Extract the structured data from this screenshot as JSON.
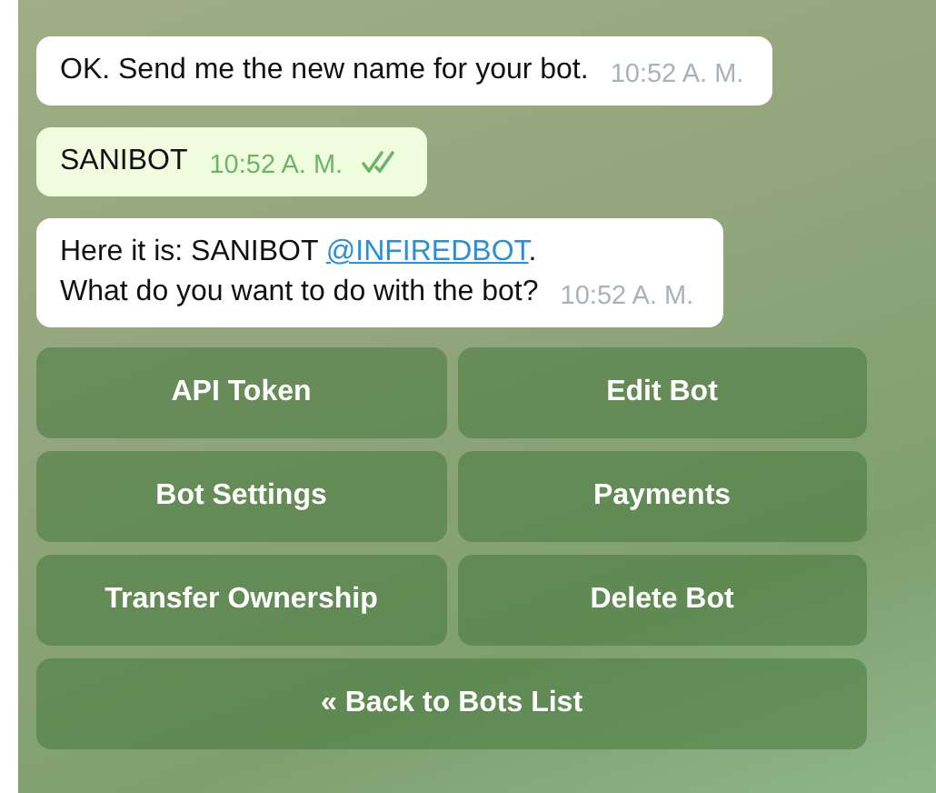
{
  "messages": [
    {
      "kind": "incoming",
      "lines": [
        [
          {
            "kind": "text",
            "text": "OK. Send me the new name for your bot."
          }
        ]
      ],
      "time": "10:52 A. M."
    },
    {
      "kind": "outgoing",
      "lines": [
        [
          {
            "kind": "text",
            "text": "SANIBOT"
          }
        ]
      ],
      "time": "10:52 A. M.",
      "read": true
    },
    {
      "kind": "incoming",
      "lines": [
        [
          {
            "kind": "text",
            "text": "Here it is: SANIBOT "
          },
          {
            "kind": "link",
            "text": "@INFIREDBOT"
          },
          {
            "kind": "text",
            "text": "."
          }
        ],
        [
          {
            "kind": "text",
            "text": "What do you want to do with the bot?"
          }
        ]
      ],
      "time": "10:52 A. M."
    }
  ],
  "keyboard": [
    [
      "API Token",
      "Edit Bot"
    ],
    [
      "Bot Settings",
      "Payments"
    ],
    [
      "Transfer Ownership",
      "Delete Bot"
    ],
    [
      "« Back to Bots List"
    ]
  ]
}
